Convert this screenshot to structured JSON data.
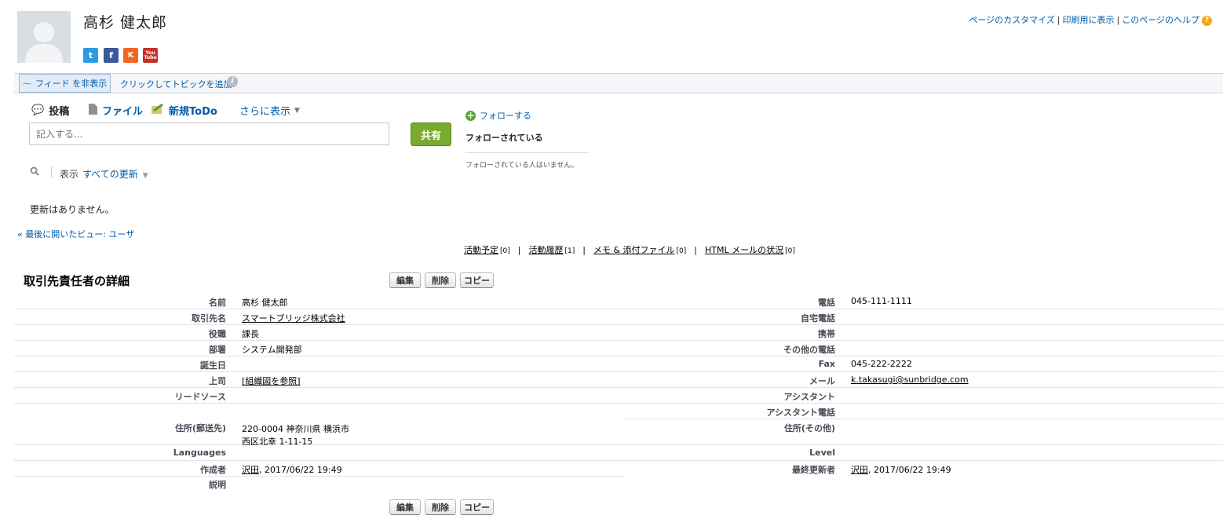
{
  "header": {
    "name": "高杉 健太郎",
    "social": {
      "twitter": "t",
      "facebook": "f",
      "klout": "K",
      "youtube_top": "You",
      "youtube_bottom": "Tube"
    },
    "top_links": [
      "ページのカスタマイズ",
      "印刷用に表示",
      "このページのヘルプ"
    ],
    "separator": "|",
    "help_icon": "?"
  },
  "chatter_bar": {
    "hide_feed_label": "フィード を非表示",
    "add_topic_label": "クリックしてトピックを追加:",
    "info_icon": "i"
  },
  "publisher": {
    "tabs": {
      "post": "投稿",
      "file": "ファイル",
      "todo": "新規ToDo",
      "more": "さらに表示"
    },
    "input_placeholder": "記入する...",
    "share_label": "共有"
  },
  "followers": {
    "follow_label": "フォローする",
    "title": "フォローされている",
    "empty_text": "フォローされている人はいません。"
  },
  "feed": {
    "filter_prefix": "表示",
    "filter_value": "すべての更新",
    "no_updates": "更新はありません。"
  },
  "last_view": "« 最後に開いたビュー: ユーザ",
  "related_links": [
    {
      "label": "活動予定",
      "count": "[0]"
    },
    {
      "label": "活動履歴",
      "count": "[1]"
    },
    {
      "label": "メモ & 添付ファイル",
      "count": "[0]"
    },
    {
      "label": "HTML メールの状況",
      "count": "[0]"
    }
  ],
  "detail": {
    "title": "取引先責任者の詳細",
    "buttons": {
      "edit": "編集",
      "delete": "削除",
      "copy": "コピー"
    },
    "left_fields": [
      {
        "label": "名前",
        "value": "高杉 健太郎"
      },
      {
        "label": "取引先名",
        "value": "スマートブリッジ株式会社",
        "link": true
      },
      {
        "label": "役職",
        "value": "課長"
      },
      {
        "label": "部署",
        "value": "システム開発部"
      },
      {
        "label": "誕生日",
        "value": ""
      },
      {
        "label": "上司",
        "value": "[組織図を参照]",
        "link": true
      },
      {
        "label": "リードソース",
        "value": ""
      },
      {
        "label": "住所(郵送先)",
        "value_line1": "220-0004 神奈川県 横浜市",
        "value_line2": "西区北幸 1-11-15"
      },
      {
        "label": "Languages",
        "value": ""
      },
      {
        "label": "作成者",
        "user": "沢田",
        "value": ", 2017/06/22 19:49"
      },
      {
        "label": "説明",
        "value": ""
      }
    ],
    "right_fields": [
      {
        "label": "電話",
        "value": "045-111-1111"
      },
      {
        "label": "自宅電話",
        "value": ""
      },
      {
        "label": "携帯",
        "value": ""
      },
      {
        "label": "その他の電話",
        "value": ""
      },
      {
        "label": "Fax",
        "value": "045-222-2222"
      },
      {
        "label": "メール",
        "value": "k.takasugi@sunbridge.com",
        "link": true
      },
      {
        "label": "アシスタント",
        "value": ""
      },
      {
        "label": "アシスタント電話",
        "value": ""
      },
      {
        "label": "住所(その他)",
        "value": ""
      },
      {
        "label": "Level",
        "value": ""
      },
      {
        "label": "最終更新者",
        "user": "沢田",
        "value": ", 2017/06/22 19:49"
      }
    ]
  }
}
